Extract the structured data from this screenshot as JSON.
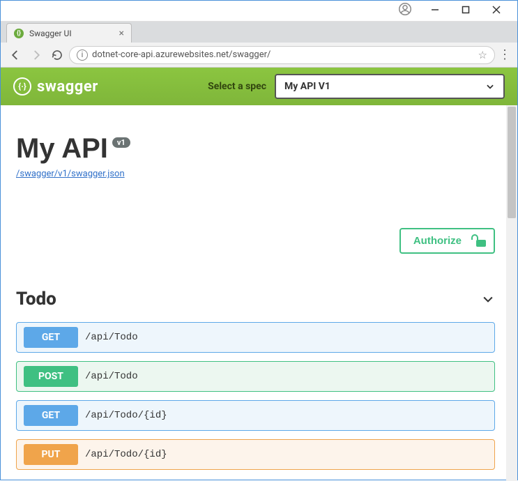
{
  "window": {
    "tab_title": "Swagger UI"
  },
  "browser": {
    "url": "dotnet-core-api.azurewebsites.net/swagger/"
  },
  "swagger_header": {
    "brand": "swagger",
    "select_label": "Select a spec",
    "selected_spec": "My API V1"
  },
  "api": {
    "title": "My API",
    "version_badge": "v1",
    "spec_link": "/swagger/v1/swagger.json",
    "authorize_label": "Authorize"
  },
  "tag": {
    "name": "Todo"
  },
  "operations": [
    {
      "method": "GET",
      "css": "get",
      "path": "/api/Todo"
    },
    {
      "method": "POST",
      "css": "post",
      "path": "/api/Todo"
    },
    {
      "method": "GET",
      "css": "get",
      "path": "/api/Todo/{id}"
    },
    {
      "method": "PUT",
      "css": "put",
      "path": "/api/Todo/{id}"
    }
  ]
}
